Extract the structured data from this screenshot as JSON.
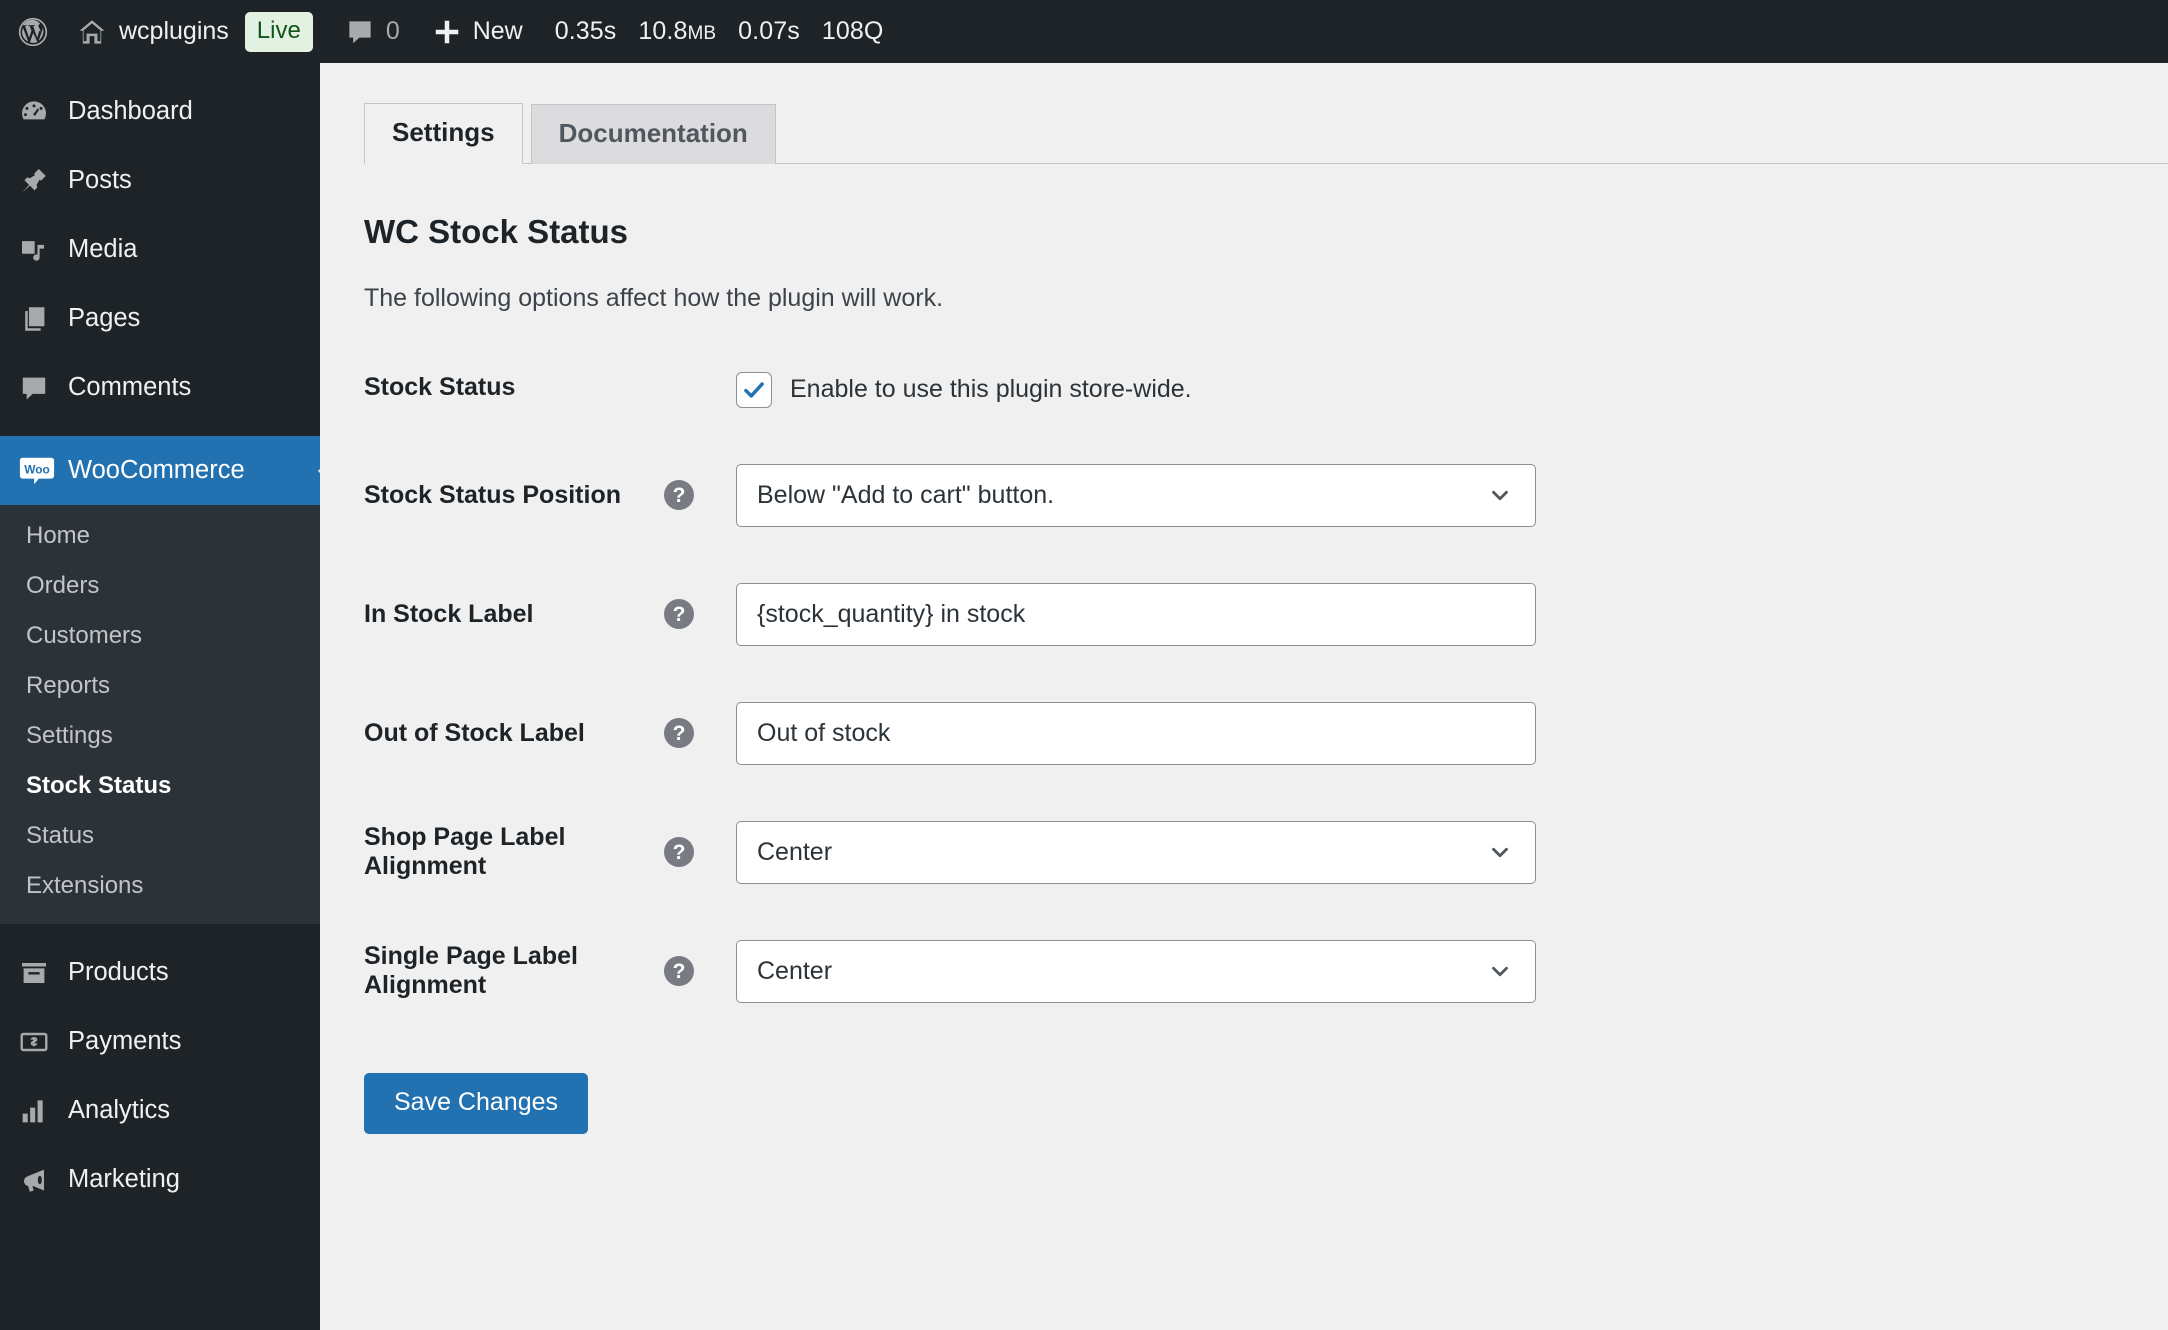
{
  "adminbar": {
    "logo_icon": "wordpress-logo-icon",
    "home_icon": "home-icon",
    "site_name": "wcplugins",
    "live_badge": "Live",
    "comments_icon": "comment-bubble-icon",
    "comments_count": "0",
    "new_icon": "plus-icon",
    "new_label": "New",
    "perf": [
      "0.35s",
      "10.8",
      "MB",
      "0.07s",
      "108Q"
    ],
    "perf_time": "0.35s",
    "perf_memory_value": "10.8",
    "perf_memory_unit": "MB",
    "perf_db_time": "0.07s",
    "perf_queries": "108Q"
  },
  "sidebar": {
    "items": [
      {
        "label": "Dashboard",
        "icon": "dashboard-icon",
        "current": false
      },
      {
        "label": "Posts",
        "icon": "pin-icon",
        "current": false
      },
      {
        "label": "Media",
        "icon": "media-icon",
        "current": false
      },
      {
        "label": "Pages",
        "icon": "pages-icon",
        "current": false
      },
      {
        "label": "Comments",
        "icon": "comment-bubble-icon",
        "current": false
      },
      {
        "label": "WooCommerce",
        "icon": "woo-logo-icon",
        "current": true
      },
      {
        "label": "Products",
        "icon": "products-box-icon",
        "current": false
      },
      {
        "label": "Payments",
        "icon": "payments-icon",
        "current": false
      },
      {
        "label": "Analytics",
        "icon": "analytics-bars-icon",
        "current": false
      },
      {
        "label": "Marketing",
        "icon": "megaphone-icon",
        "current": false
      }
    ],
    "woo_submenu": [
      {
        "label": "Home",
        "current": false
      },
      {
        "label": "Orders",
        "current": false
      },
      {
        "label": "Customers",
        "current": false
      },
      {
        "label": "Reports",
        "current": false
      },
      {
        "label": "Settings",
        "current": false
      },
      {
        "label": "Stock Status",
        "current": true
      },
      {
        "label": "Status",
        "current": false
      },
      {
        "label": "Extensions",
        "current": false
      }
    ],
    "woo_logo_text": "Woo"
  },
  "content": {
    "tabs": [
      {
        "label": "Settings",
        "active": true
      },
      {
        "label": "Documentation",
        "active": false
      }
    ],
    "title": "WC Stock Status",
    "description": "The following options affect how the plugin will work.",
    "fields": {
      "stock_status": {
        "label": "Stock Status",
        "checkbox_label": "Enable to use this plugin store-wide.",
        "checked": true
      },
      "stock_status_position": {
        "label": "Stock Status Position",
        "help": "?",
        "value": "Below \"Add to cart\" button.",
        "type": "select"
      },
      "in_stock_label": {
        "label": "In Stock Label",
        "help": "?",
        "value": "{stock_quantity} in stock",
        "type": "text"
      },
      "out_of_stock_label": {
        "label": "Out of Stock Label",
        "help": "?",
        "value": "Out of stock",
        "type": "text"
      },
      "shop_page_alignment": {
        "label": "Shop Page Label Alignment",
        "help": "?",
        "value": "Center",
        "type": "select"
      },
      "single_page_alignment": {
        "label": "Single Page Label Alignment",
        "help": "?",
        "value": "Center",
        "type": "select"
      }
    },
    "save_button": "Save Changes"
  },
  "colors": {
    "admin_bar_bg": "#1d2327",
    "accent_blue": "#2271b1",
    "submenu_bg": "#2c3338",
    "page_bg": "#f0f0f1",
    "live_badge_bg": "#e3f1e3",
    "live_badge_text": "#12541a"
  }
}
